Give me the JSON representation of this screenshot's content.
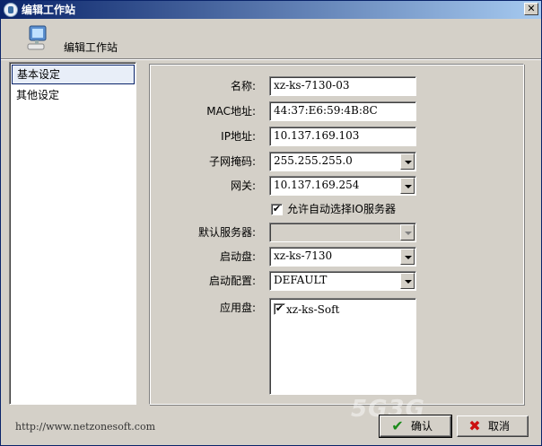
{
  "window": {
    "title": "编辑工作站",
    "close_glyph": "✕"
  },
  "header": {
    "title": "编辑工作站",
    "icon": "computer-icon"
  },
  "nav": {
    "items": [
      {
        "label": "基本设定",
        "selected": true
      },
      {
        "label": "其他设定",
        "selected": false
      }
    ]
  },
  "form": {
    "name": {
      "label": "名称:",
      "value": "xz-ks-7130-03"
    },
    "mac": {
      "label": "MAC地址:",
      "value": "44:37:E6:59:4B:8C"
    },
    "ip": {
      "label": "IP地址:",
      "value": "10.137.169.103"
    },
    "subnet": {
      "label": "子网掩码:",
      "value": "255.255.255.0"
    },
    "gateway": {
      "label": "网关:",
      "value": "10.137.169.254"
    },
    "auto_io": {
      "label": "允许自动选择IO服务器",
      "checked": true
    },
    "default_server": {
      "label": "默认服务器:",
      "value": ""
    },
    "boot_disk": {
      "label": "启动盘:",
      "value": "xz-ks-7130"
    },
    "boot_config": {
      "label": "启动配置:",
      "value": "DEFAULT"
    },
    "app_disk": {
      "label": "应用盘:",
      "items": [
        {
          "label": "xz-ks-Soft",
          "checked": true
        }
      ]
    }
  },
  "footer": {
    "url": "http://www.netzonesoft.com",
    "ok_label": "确认",
    "cancel_label": "取消",
    "ok_icon": "checkmark-icon",
    "cancel_icon": "red-x-icon",
    "ok_color": "#1a8a1a",
    "cancel_color": "#cc1111"
  },
  "watermark": "5G3G"
}
